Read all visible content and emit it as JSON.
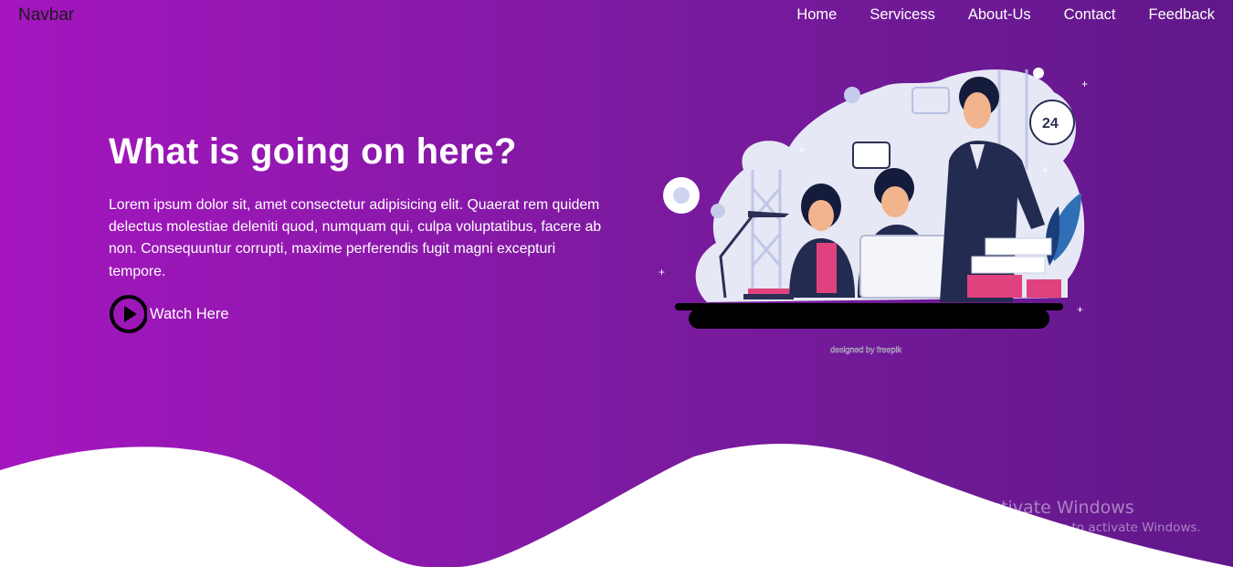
{
  "navbar": {
    "brand": "Navbar",
    "links": [
      "Home",
      "Servicess",
      "About-Us",
      "Contact",
      "Feedback"
    ]
  },
  "hero": {
    "title": "What is going on here?",
    "text": "Lorem ipsum dolor sit, amet consectetur adipisicing elit. Quaerat rem quidem delectus molestiae deleniti quod, numquam qui, culpa voluptatibus, facere ab non. Consequuntur corrupti, maxime perferendis fugit magni excepturi tempore.",
    "watch_label": "Watch Here"
  },
  "illustration": {
    "clock_badge": "24",
    "credit": "designed by freepik"
  },
  "watermark": {
    "line1": "Activate Windows",
    "line2": "Go to Settings to activate Windows."
  },
  "colors": {
    "gradient_left": "#a516bf",
    "gradient_right": "#61188b",
    "wave": "#ffffff"
  }
}
